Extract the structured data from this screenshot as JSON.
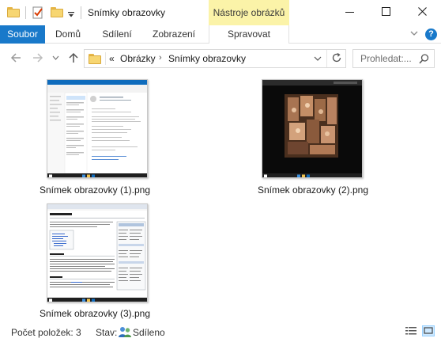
{
  "window": {
    "title": "Snímky obrazovky",
    "context_group": "Nástroje obrázků"
  },
  "ribbon": {
    "file_tab": "Soubor",
    "tabs": [
      "Domů",
      "Sdílení",
      "Zobrazení",
      "Spravovat"
    ]
  },
  "address": {
    "overflow": "«",
    "crumbs": [
      "Obrázky",
      "Snímky obrazovky"
    ]
  },
  "search": {
    "placeholder": "Prohledat:..."
  },
  "files": [
    {
      "name": "Snímek obrazovky (1).png"
    },
    {
      "name": "Snímek obrazovky (2).png"
    },
    {
      "name": "Snímek obrazovky (3).png"
    }
  ],
  "status": {
    "items": "Počet položek: 3",
    "state_label": "Stav:",
    "state_value": "Sdíleno"
  },
  "colors": {
    "accent": "#1979ca",
    "context_tab": "#fbf3a8",
    "folder": "#f7d672"
  },
  "icons": [
    "folder-icon",
    "properties-icon",
    "new-folder-icon",
    "minimize-icon",
    "maximize-icon",
    "close-icon",
    "back-arrow-icon",
    "forward-arrow-icon",
    "up-arrow-icon",
    "refresh-icon",
    "search-icon",
    "shared-users-icon",
    "details-view-icon",
    "large-icons-view-icon",
    "help-icon"
  ]
}
